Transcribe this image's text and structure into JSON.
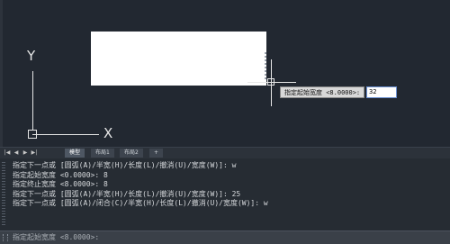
{
  "dynamic_input": {
    "prompt": "指定起始宽度 <8.0000>:",
    "value": "32"
  },
  "ucs": {
    "x_label": "X",
    "y_label": "Y"
  },
  "tabs": {
    "nav_first": "|◀",
    "nav_prev": "◀",
    "nav_next": "▶",
    "nav_last": "▶|",
    "items": [
      "模型",
      "布局1",
      "布局2",
      "+"
    ],
    "active": "模型"
  },
  "history": [
    "指定下一点或 [圆弧(A)/半宽(H)/长度(L)/撤消(U)/宽度(W)]: w",
    "指定起始宽度 <0.0000>: 8",
    "指定终止宽度 <8.0000>: 8",
    "指定下一点或 [圆弧(A)/半宽(H)/长度(L)/撤消(U)/宽度(W)]: 25",
    "指定下一点或 [圆弧(A)/闭合(C)/半宽(H)/长度(L)/撤消(U)/宽度(W)]: w"
  ],
  "command_line": {
    "prompt": "指定起始宽度 <8.0000>:"
  },
  "colors": {
    "canvas": "#222831",
    "drawing_fill": "#ffffff",
    "active_tab": "#4e5763"
  }
}
